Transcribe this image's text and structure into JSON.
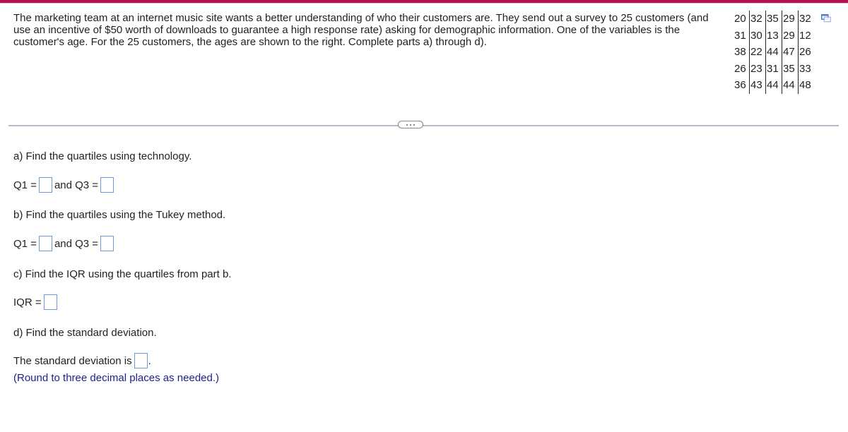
{
  "intro_text": "The marketing team at an internet music site wants a better understanding of who their customers are. They send out a survey to 25 customers (and use an incentive of $50 worth of downloads to guarantee a high response rate) asking for demographic information. One of the variables is the customer's age. For the 25 customers, the ages are shown to the right. Complete parts a) through d).",
  "ages_table": [
    [
      "20",
      "32",
      "35",
      "29",
      "32"
    ],
    [
      "31",
      "30",
      "13",
      "29",
      "12"
    ],
    [
      "38",
      "22",
      "44",
      "47",
      "26"
    ],
    [
      "26",
      "23",
      "31",
      "35",
      "33"
    ],
    [
      "36",
      "43",
      "44",
      "44",
      "48"
    ]
  ],
  "icons": {
    "copy": "copy-data-icon",
    "expand": "more-dots-icon"
  },
  "colors": {
    "top_bar": "#b0124f",
    "answer_box_border": "#6f97d9",
    "note_text": "#1f1f8a"
  },
  "parts": {
    "a": {
      "prompt": "a) Find the quartiles using technology.",
      "q1_label": "Q1 =",
      "and_q3_label": "and Q3 =",
      "q1_value": "",
      "q3_value": ""
    },
    "b": {
      "prompt": "b) Find the quartiles using the Tukey method.",
      "q1_label": "Q1 =",
      "and_q3_label": "and Q3 =",
      "q1_value": "",
      "q3_value": ""
    },
    "c": {
      "prompt": "c) Find the IQR using the quartiles from part b.",
      "iqr_label": "IQR =",
      "iqr_value": ""
    },
    "d": {
      "prompt": "d) Find the standard deviation.",
      "sd_label": "The standard deviation is",
      "sd_suffix": ".",
      "sd_value": "",
      "note": "(Round to three decimal places as needed.)"
    }
  }
}
